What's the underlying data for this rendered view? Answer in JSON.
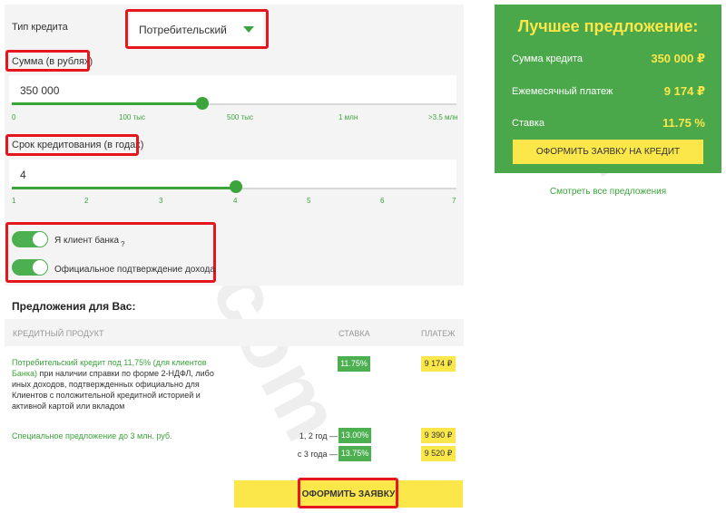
{
  "calculator": {
    "credit_type_label": "Тип кредита",
    "credit_type_value": "Потребительский",
    "amount_label": "Сумма (в рублях)",
    "amount_value": "350 000",
    "amount_ticks": [
      "0",
      "100 тыс",
      "500 тыс",
      "1 млн",
      ">3.5 млн"
    ],
    "amount_slider_level": 0.42,
    "term_label": "Срок кредитования (в годах)",
    "term_value": "4",
    "term_ticks": [
      "1",
      "2",
      "3",
      "4",
      "5",
      "6",
      "7"
    ],
    "term_slider_value": 4,
    "toggle_client_label": "Я клиент банка",
    "toggle_client_help": "?",
    "toggle_client_on": true,
    "toggle_income_label": "Официальное подтверждение дохода",
    "toggle_income_on": true
  },
  "best_offer": {
    "title": "Лучшее предложение:",
    "amount_label": "Сумма кредита",
    "amount_value": "350 000 ₽",
    "payment_label": "Ежемесячный платеж",
    "payment_value": "9 174 ₽",
    "rate_label": "Ставка",
    "rate_value": "11.75 %",
    "apply_button": "Оформить заявку на кредит",
    "all_offers_link": "Смотреть все предложения"
  },
  "offers": {
    "title": "Предложения для Вас:",
    "col_product": "КРЕДИТНЫЙ ПРОДУКТ",
    "col_rate": "СТАВКА",
    "col_payment": "ПЛАТЕЖ",
    "rows": [
      {
        "product_link": "Потребительский кредит под 11,75% (для клиентов Банка)",
        "product_text": " при наличии справки по форме 2-НДФЛ, либо иных доходов, подтвержденных официально для Клиентов с положительной кредитной историей и активной картой или вкладом",
        "rate": "11.75%",
        "payment": "9 174 ₽"
      },
      {
        "product_link": "Специальное предложение до 3 млн. руб.",
        "sub": [
          {
            "period": "1, 2 год —",
            "rate": "13.00%",
            "payment": "9 390 ₽"
          },
          {
            "period": "с 3 года —",
            "rate": "13.75%",
            "payment": "9 520 ₽"
          }
        ]
      }
    ],
    "apply_button": "ОФОРМИТЬ ЗАЯВКУ"
  },
  "colors": {
    "accent_green": "#4aa84a",
    "accent_yellow": "#fbe74a",
    "highlight_red": "#e5161d"
  }
}
